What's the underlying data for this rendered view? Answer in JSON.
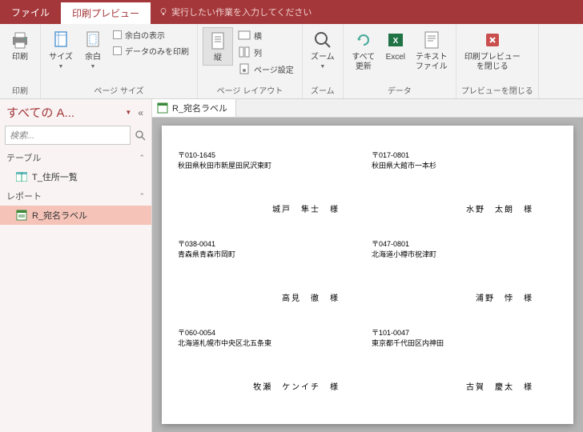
{
  "titlebar": {
    "tabs": [
      {
        "label": "ファイル"
      },
      {
        "label": "印刷プレビュー"
      }
    ],
    "tell_me": "実行したい作業を入力してください"
  },
  "ribbon": {
    "g_print": {
      "label": "印刷",
      "btn_print": "印刷"
    },
    "g_pagesize": {
      "label": "ページ サイズ",
      "btn_size": "サイズ",
      "btn_margin": "余白",
      "chk_show_margin": "余白の表示",
      "chk_data_only": "データのみを印刷"
    },
    "g_layout": {
      "label": "ページ レイアウト",
      "btn_portrait": "縦",
      "btn_landscape": "横",
      "btn_columns": "列",
      "btn_page_setup": "ページ設定"
    },
    "g_zoom": {
      "label": "ズーム",
      "btn_zoom": "ズーム"
    },
    "g_data": {
      "label": "データ",
      "btn_refresh": "すべて\n更新",
      "btn_excel": "Excel",
      "btn_text": "テキスト\nファイル"
    },
    "g_close": {
      "label": "プレビューを閉じる",
      "btn_close": "印刷プレビュー\nを閉じる"
    }
  },
  "nav": {
    "title": "すべての A...",
    "search_placeholder": "検索...",
    "sections": {
      "tables": "テーブル",
      "reports": "レポート"
    },
    "items": {
      "table1": "T_住所一覧",
      "report1": "R_宛名ラベル"
    }
  },
  "doc": {
    "tab_title": "R_宛名ラベル"
  },
  "labels": [
    {
      "postal": "〒010-1645",
      "addr": "秋田県秋田市新屋田尻沢東町",
      "name": "城戸　隼士　様"
    },
    {
      "postal": "〒017-0801",
      "addr": "秋田県大館市一本杉",
      "name": "水野　太朗　様"
    },
    {
      "postal": "〒038-0041",
      "addr": "青森県青森市岡町",
      "name": "高見　徹　様"
    },
    {
      "postal": "〒047-0801",
      "addr": "北海道小樽市祝津町",
      "name": "浦野　悖　様"
    },
    {
      "postal": "〒060-0054",
      "addr": "北海道札幌市中央区北五条東",
      "name": "牧瀬　ケンイチ　様"
    },
    {
      "postal": "〒101-0047",
      "addr": "東京都千代田区内神田",
      "name": "古賀　慶太　様"
    }
  ]
}
